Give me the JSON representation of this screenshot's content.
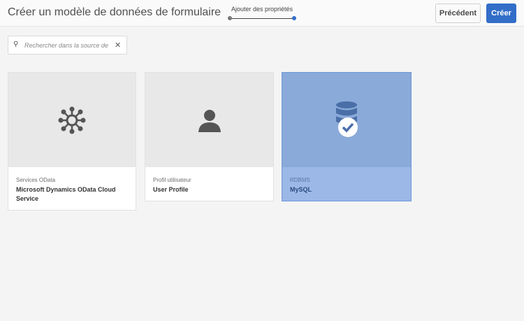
{
  "header": {
    "title": "Créer un modèle de données de formulaire",
    "step_label": "Ajouter des propriétés",
    "prev_label": "Précédent",
    "create_label": "Créer"
  },
  "search": {
    "placeholder": "Rechercher dans la source de d"
  },
  "cards": [
    {
      "type": "Services OData",
      "name": "Microsoft Dynamics OData Cloud Service",
      "icon": "network-hub-icon",
      "selected": false
    },
    {
      "type": "Profil utilisateur",
      "name": "User Profile",
      "icon": "user-icon",
      "selected": false
    },
    {
      "type": "RDBMS",
      "name": "MySQL",
      "icon": "database-icon",
      "selected": true
    }
  ],
  "colors": {
    "accent": "#326ec8",
    "selected_card": "#8aaad9"
  }
}
